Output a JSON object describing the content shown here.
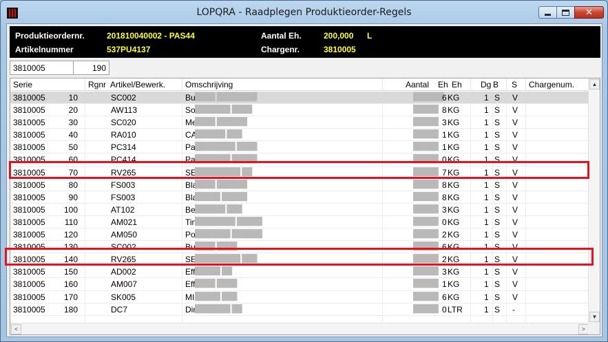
{
  "window": {
    "title": "LOPQRA - Raadplegen Produktieorder-Regels",
    "buttons": {
      "minimize": "minimize",
      "maximize": "maximize",
      "close": "✕"
    }
  },
  "header": {
    "order_label": "Produktieordernr.",
    "order_value": "201810040002 - PAS44",
    "article_label": "Artikelnummer",
    "article_value": "537PU4137",
    "qty_label": "Aantal Eh.",
    "qty_value": "200,000",
    "qty_unit": "L",
    "charge_label": "Chargenr.",
    "charge_value": "3810005"
  },
  "filter": {
    "serie": "3810005",
    "rgnr": "190"
  },
  "grid": {
    "columns": [
      "Serie",
      "Rgnr",
      "Artikel/Bewerk.",
      "Omschrijving",
      "Aantal",
      "Eh",
      "Eh",
      "Dg",
      "B",
      "S",
      "Chargenum."
    ],
    "rows": [
      {
        "serie": "3810005",
        "rgnr": "10",
        "art": "SC002",
        "oms_prefix": "Bu",
        "oms_blur": "████ ████████",
        "aantal_blur": "██████",
        "aantal_tail": "6",
        "eh": "KG",
        "dg": "1",
        "b": "S",
        "s": "V"
      },
      {
        "serie": "3810005",
        "rgnr": "20",
        "art": "AW113",
        "oms_prefix": "So",
        "oms_blur": "███████ ████",
        "aantal_blur": "█████",
        "aantal_tail": "8",
        "eh": "KG",
        "dg": "1",
        "b": "S",
        "s": "V"
      },
      {
        "serie": "3810005",
        "rgnr": "30",
        "art": "SC020",
        "oms_prefix": "Me",
        "oms_blur": "████ ██████",
        "aantal_blur": "█████",
        "aantal_tail": "3",
        "eh": "KG",
        "dg": "1",
        "b": "S",
        "s": "V"
      },
      {
        "serie": "3810005",
        "rgnr": "40",
        "art": "RA010",
        "oms_prefix": "CA",
        "oms_blur": "██████ ███",
        "aantal_blur": "█████",
        "aantal_tail": "1",
        "eh": "KG",
        "dg": "1",
        "b": "S",
        "s": "V"
      },
      {
        "serie": "3810005",
        "rgnr": "50",
        "art": "PC314",
        "oms_prefix": "Pa",
        "oms_blur": "████████ ████",
        "aantal_blur": "█████",
        "aantal_tail": "1",
        "eh": "KG",
        "dg": "1",
        "b": "S",
        "s": "V"
      },
      {
        "serie": "3810005",
        "rgnr": "60",
        "art": "PC414",
        "oms_prefix": "Pa",
        "oms_blur": "███████ █████",
        "aantal_blur": "█████",
        "aantal_tail": "0",
        "eh": "KG",
        "dg": "1",
        "b": "S",
        "s": "V"
      },
      {
        "serie": "3810005",
        "rgnr": "70",
        "art": "RV265",
        "oms_prefix": "SE",
        "oms_blur": "█████████ ██",
        "aantal_blur": "█████",
        "aantal_tail": "7",
        "eh": "KG",
        "dg": "1",
        "b": "S",
        "s": "V"
      },
      {
        "serie": "3810005",
        "rgnr": "80",
        "art": "FS003",
        "oms_prefix": "Bla",
        "oms_blur": "████ ██████",
        "aantal_blur": "█████",
        "aantal_tail": "8",
        "eh": "KG",
        "dg": "1",
        "b": "S",
        "s": "V"
      },
      {
        "serie": "3810005",
        "rgnr": "90",
        "art": "FS003",
        "oms_prefix": "Bla",
        "oms_blur": "█████ █████",
        "aantal_blur": "█████",
        "aantal_tail": "8",
        "eh": "KG",
        "dg": "1",
        "b": "S",
        "s": "V"
      },
      {
        "serie": "3810005",
        "rgnr": "100",
        "art": "AT102",
        "oms_prefix": "Be",
        "oms_blur": "██████ ███",
        "aantal_blur": "█████",
        "aantal_tail": "3",
        "eh": "KG",
        "dg": "1",
        "b": "S",
        "s": "V"
      },
      {
        "serie": "3810005",
        "rgnr": "110",
        "art": "AM021",
        "oms_prefix": "Tin",
        "oms_blur": "████████ █████",
        "aantal_blur": "█████",
        "aantal_tail": "0",
        "eh": "KG",
        "dg": "1",
        "b": "S",
        "s": "V"
      },
      {
        "serie": "3810005",
        "rgnr": "120",
        "art": "AM050",
        "oms_prefix": "Po",
        "oms_blur": "███████ ██████",
        "aantal_blur": "█████",
        "aantal_tail": "2",
        "eh": "KG",
        "dg": "1",
        "b": "S",
        "s": "V"
      },
      {
        "serie": "3810005",
        "rgnr": "130",
        "art": "SC002",
        "oms_prefix": "Bu",
        "oms_blur": "████ ████",
        "aantal_blur": "█████",
        "aantal_tail": "6",
        "eh": "KG",
        "dg": "1",
        "b": "S",
        "s": "V"
      },
      {
        "serie": "3810005",
        "rgnr": "140",
        "art": "RV265",
        "oms_prefix": "SE",
        "oms_blur": "█████████ ███",
        "aantal_blur": "█████",
        "aantal_tail": "2",
        "eh": "KG",
        "dg": "1",
        "b": "S",
        "s": "V"
      },
      {
        "serie": "3810005",
        "rgnr": "150",
        "art": "AD002",
        "oms_prefix": "Eff",
        "oms_blur": "█████ ██",
        "aantal_blur": "█████",
        "aantal_tail": "3",
        "eh": "KG",
        "dg": "1",
        "b": "S",
        "s": "V"
      },
      {
        "serie": "3810005",
        "rgnr": "160",
        "art": "AM007",
        "oms_prefix": "Eff",
        "oms_blur": "████ ████",
        "aantal_blur": "█████",
        "aantal_tail": "1",
        "eh": "KG",
        "dg": "1",
        "b": "S",
        "s": "V"
      },
      {
        "serie": "3810005",
        "rgnr": "170",
        "art": "SK005",
        "oms_prefix": "MI",
        "oms_blur": "█████ ███",
        "aantal_blur": "█████",
        "aantal_tail": "6",
        "eh": "KG",
        "dg": "1",
        "b": "S",
        "s": "V"
      },
      {
        "serie": "3810005",
        "rgnr": "180",
        "art": "DC7",
        "oms_prefix": "Dir",
        "oms_blur": "███████ ██",
        "aantal_blur": "█████",
        "aantal_tail": "0",
        "eh": "LTR",
        "dg": "1",
        "b": "S",
        "s": "-"
      }
    ]
  },
  "scroll": {
    "up": "▲",
    "down": "▼",
    "left": "<",
    "right": ">"
  },
  "colors": {
    "highlight": "#e8101e",
    "header_bg": "#000000",
    "header_label": "#ffffff",
    "header_value": "#ffff35",
    "selected_row": "#d9d9d9"
  }
}
